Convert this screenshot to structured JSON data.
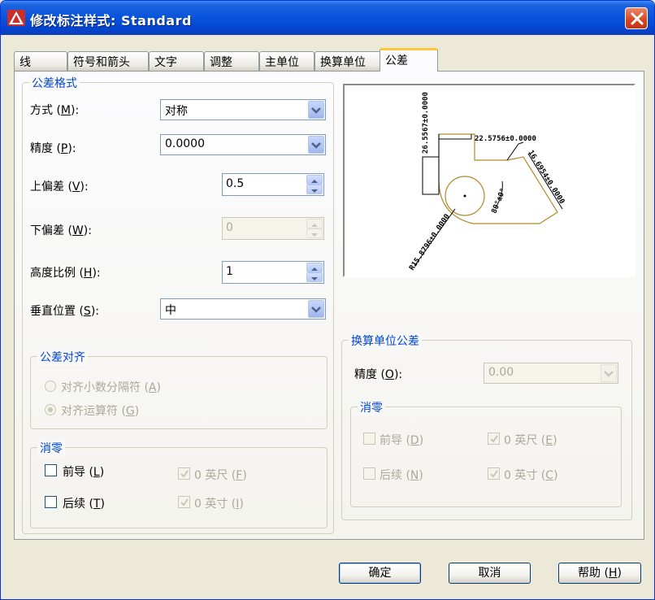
{
  "window": {
    "title": "修改标注样式: Standard"
  },
  "tabs": [
    {
      "label": "线"
    },
    {
      "label": "符号和箭头"
    },
    {
      "label": "文字"
    },
    {
      "label": "调整"
    },
    {
      "label": "主单位"
    },
    {
      "label": "换算单位"
    },
    {
      "label": "公差"
    }
  ],
  "tolerance_format": {
    "title": "公差格式",
    "method": {
      "label": "方式",
      "key": "M",
      "value": "对称"
    },
    "precision": {
      "label": "精度",
      "key": "P",
      "value": "0.0000"
    },
    "upper": {
      "label": "上偏差",
      "key": "V",
      "value": "0.5"
    },
    "lower": {
      "label": "下偏差",
      "key": "W",
      "value": "0"
    },
    "height_scale": {
      "label": "高度比例",
      "key": "H",
      "value": "1"
    },
    "vertical_position": {
      "label": "垂直位置",
      "key": "S",
      "value": "中"
    }
  },
  "tolerance_alignment": {
    "title": "公差对齐",
    "opt_decimal": {
      "label": "对齐小数分隔符",
      "key": "A"
    },
    "opt_operator": {
      "label": "对齐运算符",
      "key": "G"
    }
  },
  "zero_suppression": {
    "title": "消零",
    "leading": {
      "label": "前导",
      "key": "L"
    },
    "trailing": {
      "label": "后续",
      "key": "T"
    },
    "feet": {
      "label": "0 英尺",
      "key": "F"
    },
    "inches": {
      "label": "0 英寸",
      "key": "I"
    }
  },
  "alt_unit_tolerance": {
    "title": "换算单位公差",
    "precision": {
      "label": "精度",
      "key": "O",
      "value": "0.00"
    },
    "zero_title": "消零",
    "leading": {
      "label": "前导",
      "key": "D"
    },
    "trailing": {
      "label": "后续",
      "key": "N"
    },
    "feet": {
      "label": "0 英尺",
      "key": "E"
    },
    "inches": {
      "label": "0 英寸",
      "key": "C"
    }
  },
  "preview": {
    "dim_top": "22.5756±0.0000",
    "dim_left": "26.5567±0.0000",
    "dim_right": "16.6954±0.0000",
    "dim_bottom": "R15.8796±0.0000",
    "dim_angle": "80°±0°"
  },
  "buttons": {
    "ok": "确定",
    "cancel": "取消",
    "help": "帮助",
    "help_key": "H"
  },
  "colors": {
    "title_bar": "#0a55dc",
    "group_title": "#0046d5",
    "active_tab_accent": "#ffc83c"
  }
}
